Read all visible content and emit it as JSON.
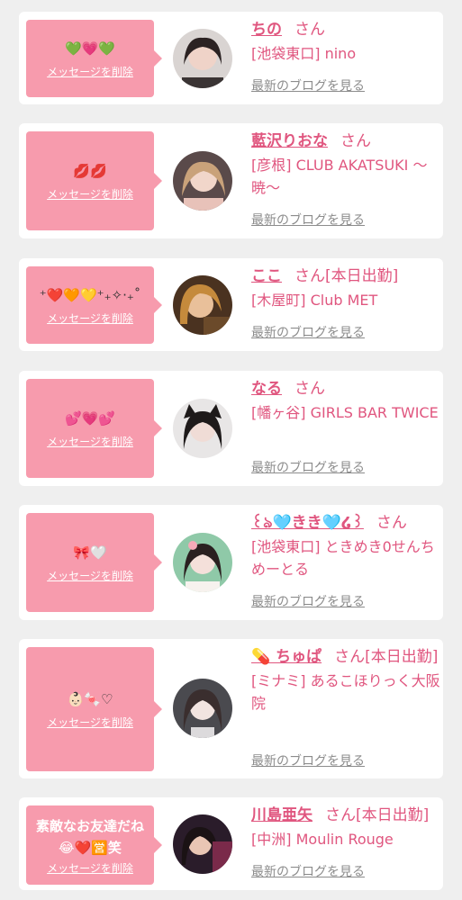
{
  "entries": [
    {
      "message": "💚💗💚",
      "delete_label": "メッセージを削除",
      "name": "ちの",
      "honorific": "さん",
      "status": "",
      "area": "[池袋東口]",
      "shop": "nino",
      "blog_label": "最新のブログを見る",
      "avatar_icon": "avatar-photo-girl"
    },
    {
      "message": "💋💋",
      "delete_label": "メッセージを削除",
      "name": "藍沢りおな",
      "honorific": "さん",
      "status": "",
      "area": "[彦根]",
      "shop": "CLUB AKATSUKI 〜暁〜",
      "blog_label": "最新のブログを見る",
      "avatar_icon": "avatar-photo-girl"
    },
    {
      "message": "⁺❤️🧡💛⁺₊✧‧₊˚",
      "delete_label": "メッセージを削除",
      "name": "ここ",
      "honorific": "さん",
      "status": "[本日出勤]",
      "area": "[木屋町]",
      "shop": "Club MET",
      "blog_label": "最新のブログを見る",
      "avatar_icon": "avatar-photo-girl"
    },
    {
      "message": "💕💗💕",
      "delete_label": "メッセージを削除",
      "name": "なる",
      "honorific": "さん",
      "status": "",
      "area": "[幡ヶ谷]",
      "shop": "GIRLS BAR TWICE",
      "blog_label": "最新のブログを見る",
      "avatar_icon": "avatar-photo-girl"
    },
    {
      "message": "🎀🤍",
      "delete_label": "メッセージを削除",
      "name": "꒰ঌ🩵きき🩵໒꒱",
      "honorific": "さん",
      "status": "",
      "area": "[池袋東口]",
      "shop": "ときめき0せんちめーとる",
      "blog_label": "最新のブログを見る",
      "avatar_icon": "avatar-photo-girl"
    },
    {
      "message": "👶🏻🍬♡",
      "delete_label": "メッセージを削除",
      "name": "💊 ちゅぱ",
      "honorific": "さん",
      "status": "[本日出勤]",
      "area": "[ミナミ]",
      "shop": "あるこほりっく大阪院",
      "blog_label": "最新のブログを見る",
      "avatar_icon": "avatar-photo-girl"
    },
    {
      "message": "素敵なお友達だね😂❤️🈺笑",
      "delete_label": "メッセージを削除",
      "name": "川島亜矢",
      "honorific": "さん",
      "status": "[本日出勤]",
      "area": "[中洲]",
      "shop": "Moulin Rouge",
      "blog_label": "最新のブログを見る",
      "avatar_icon": "avatar-photo-girl"
    }
  ],
  "colors": {
    "bubble": "#f79bad",
    "name": "#e0567f",
    "link_gray": "#8c8c8c",
    "background": "#efefef"
  }
}
